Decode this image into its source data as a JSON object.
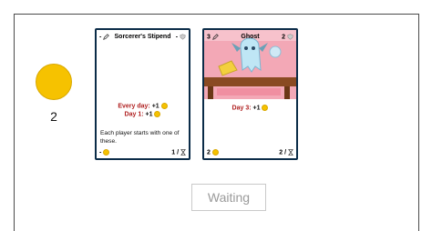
{
  "player": {
    "coins": "2",
    "coin_color": "#f6c200"
  },
  "cards": [
    {
      "cost": "-",
      "title": "Sorcerer's Stipend",
      "vp": "-",
      "effects": [
        {
          "prefix": "Every day:",
          "value": " +1"
        },
        {
          "prefix": "Day 1:",
          "value": " +1"
        }
      ],
      "description": "Each player starts with one of these.",
      "footer_left": "-",
      "footer_right": "1 /"
    },
    {
      "cost": "3",
      "title": "Ghost",
      "vp": "2",
      "effects": [
        {
          "prefix": "Day 3:",
          "value": " +1"
        }
      ],
      "footer_left": "2",
      "footer_right": "2 /"
    }
  ],
  "action": {
    "waiting_label": "Waiting"
  },
  "colors": {
    "card_border": "#0b2c48",
    "effect_text": "#b02020",
    "art_background": "#f3a8b6",
    "table": "#8a4a22"
  }
}
